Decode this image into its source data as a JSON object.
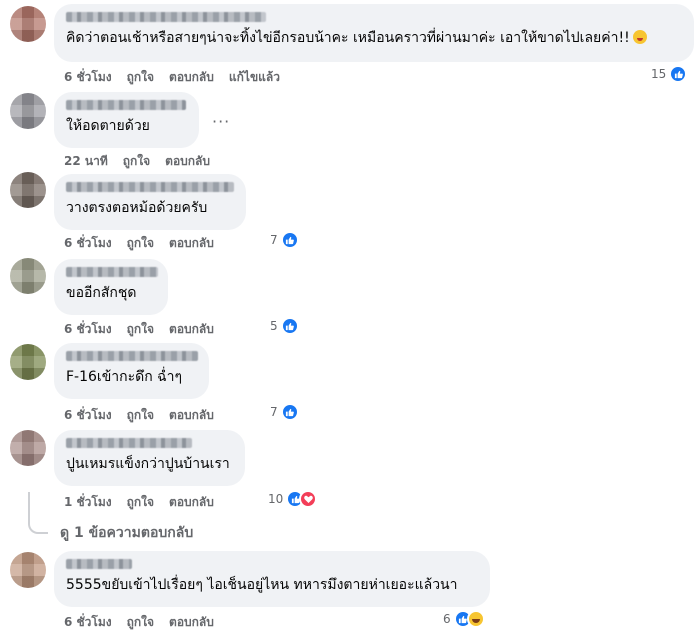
{
  "actions": {
    "like": "ถูกใจ",
    "reply": "ตอบกลับ",
    "edited": "แก้ไขแล้ว"
  },
  "comments": [
    {
      "text": "คิดว่าตอนเช้าหรือสายๆน่าจะทิ้งไข่อีกรอบน้าคะ เหมือนคราวที่ผ่านมาค่ะ เอาให้ขาดไปเลยค่า!!",
      "time": "6 ชั่วโมง",
      "reactions": "15",
      "avatar_color": "#b4786c"
    },
    {
      "text": "ให้อดตายด้วย",
      "time": "22 นาที",
      "reactions": "",
      "avatar_color": "#9a9aa0"
    },
    {
      "text": "วางตรงตอหม้อด้วยครับ",
      "time": "6 ชั่วโมง",
      "reactions": "7",
      "avatar_color": "#7a6e66"
    },
    {
      "text": "ขออีกสักชุด",
      "time": "6 ชั่วโมง",
      "reactions": "5",
      "avatar_color": "#9ea08c"
    },
    {
      "text": "F-16เข้ากะดึก ฉ่ำๆ",
      "time": "6 ชั่วโมง",
      "reactions": "7",
      "avatar_color": "#7f8c55"
    },
    {
      "text": "ปูนเหมรแข็งกว่าปูนบ้านเรา",
      "time": "1 ชั่วโมง",
      "reactions": "10",
      "avatar_color": "#a88c88"
    },
    {
      "text": "5555ขยับเข้าไปเรื่อยๆ ไอเช็นอยู่ไหน ทหารมึงตายห่าเยอะแล้วนา",
      "time": "6 ชั่วโมง",
      "reactions": "6",
      "avatar_color": "#c29a82"
    }
  ],
  "view_replies": "ดู 1 ข้อความตอบกลับ",
  "icons": {
    "more": "more-dots-icon",
    "like": "like-reaction-icon",
    "love": "love-reaction-icon",
    "haha": "haha-reaction-icon"
  }
}
